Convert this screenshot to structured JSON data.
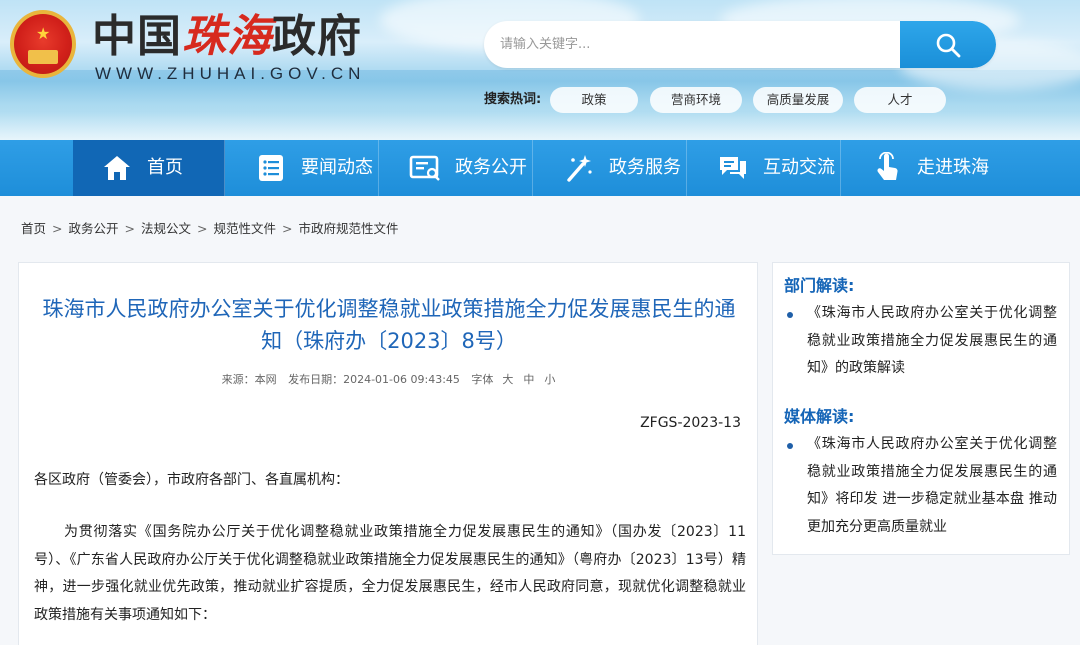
{
  "header": {
    "title_part1": "中国",
    "title_part2": "珠海",
    "title_part3": "政府",
    "url": "WWW.ZHUHAI.GOV.CN"
  },
  "search": {
    "placeholder": "请输入关键字...",
    "hot_label": "搜索热词:",
    "hot_tags": [
      "政策",
      "营商环境",
      "高质量发展",
      "人才"
    ]
  },
  "nav": {
    "items": [
      {
        "label": "首页",
        "icon": "home-icon"
      },
      {
        "label": "要闻动态",
        "icon": "news-list-icon"
      },
      {
        "label": "政务公开",
        "icon": "document-icon"
      },
      {
        "label": "政务服务",
        "icon": "service-wand-icon"
      },
      {
        "label": "互动交流",
        "icon": "chat-icon"
      },
      {
        "label": "走进珠海",
        "icon": "tap-hand-icon"
      }
    ]
  },
  "breadcrumb": [
    "首页",
    "政务公开",
    "法规公文",
    "规范性文件",
    "市政府规范性文件"
  ],
  "article": {
    "title": "珠海市人民政府办公室关于优化调整稳就业政策措施全力促发展惠民生的通知（珠府办〔2023〕8号）",
    "meta": {
      "source": "来源：本网",
      "date": "发布日期：2024-01-06 09:43:45",
      "font_label": "字体",
      "font_large": "大",
      "font_medium": "中",
      "font_small": "小"
    },
    "doc_no": "ZFGS-2023-13",
    "salutation": "各区政府（管委会），市政府各部门、各直属机构：",
    "paragraph": "为贯彻落实《国务院办公厅关于优化调整稳就业政策措施全力促发展惠民生的通知》（国办发〔2023〕11号）、《广东省人民政府办公厅关于优化调整稳就业政策措施全力促发展惠民生的通知》（粤府办〔2023〕13号）精神，进一步强化就业优先政策，推动就业扩容提质，全力促发展惠民生，经市人民政府同意，现就优化调整稳就业政策措施有关事项通知如下："
  },
  "sidebar": {
    "dept_heading": "部门解读:",
    "dept_item": "《珠海市人民政府办公室关于优化调整稳就业政策措施全力促发展惠民生的通知》的政策解读",
    "media_heading": "媒体解读:",
    "media_item": "《珠海市人民政府办公室关于优化调整稳就业政策措施全力促发展惠民生的通知》将印发 进一步稳定就业基本盘 推动更加充分更高质量就业"
  },
  "colors": {
    "nav_bg": "#1e8ed9",
    "nav_active": "#1167b5",
    "title_blue": "#1f66b8",
    "title_red": "#d72a1e"
  }
}
